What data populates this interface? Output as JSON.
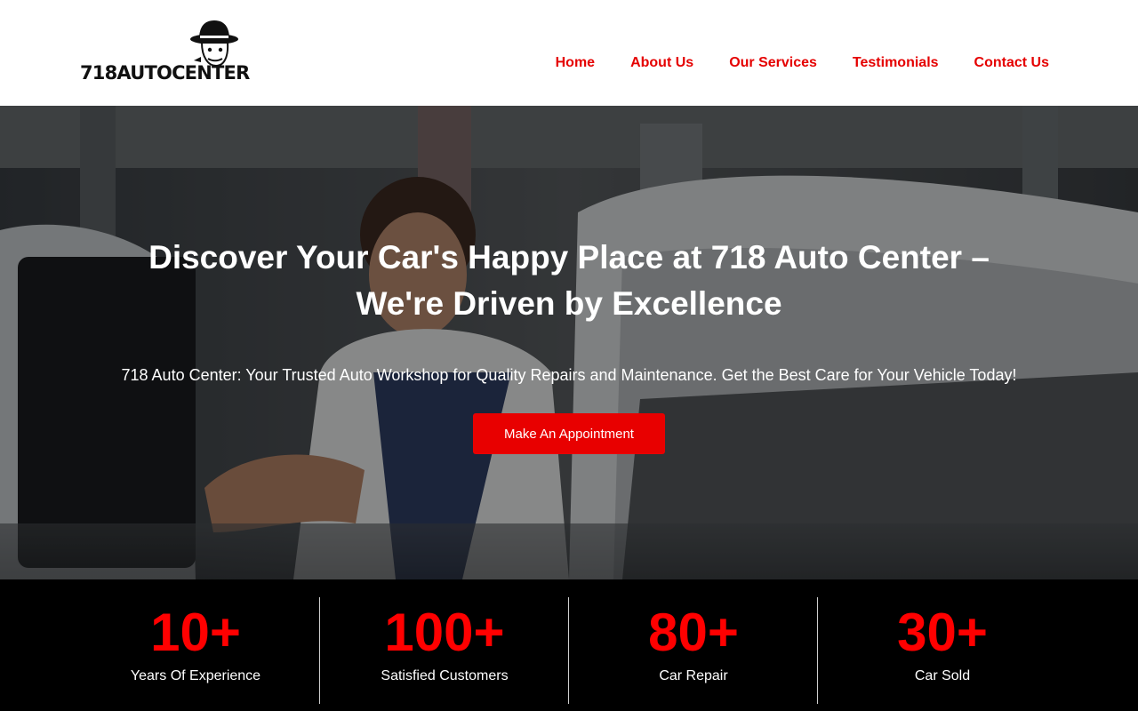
{
  "brand": {
    "logo_text": "718AUTOCENTER"
  },
  "nav": {
    "items": [
      {
        "label": "Home"
      },
      {
        "label": "About Us"
      },
      {
        "label": "Our Services"
      },
      {
        "label": "Testimonials"
      },
      {
        "label": "Contact Us"
      }
    ]
  },
  "hero": {
    "title_line1": "Discover Your Car's Happy Place at 718 Auto Center –",
    "title_line2": "We're Driven by Excellence",
    "subtitle": "718 Auto Center: Your Trusted Auto Workshop for Quality Repairs and Maintenance. Get the Best Care for Your Vehicle Today!",
    "cta_label": "Make An Appointment"
  },
  "stats": [
    {
      "value": "10+",
      "label": "Years Of Experience"
    },
    {
      "value": "100+",
      "label": "Satisfied Customers"
    },
    {
      "value": "80+",
      "label": "Car Repair"
    },
    {
      "value": "30+",
      "label": "Car Sold"
    }
  ],
  "colors": {
    "accent": "#e80000",
    "nav_text": "#e50000",
    "stat_value": "#ff0000",
    "stats_bg": "#000000"
  },
  "icons": {
    "logo_mascot": "hat-mascot-icon"
  }
}
